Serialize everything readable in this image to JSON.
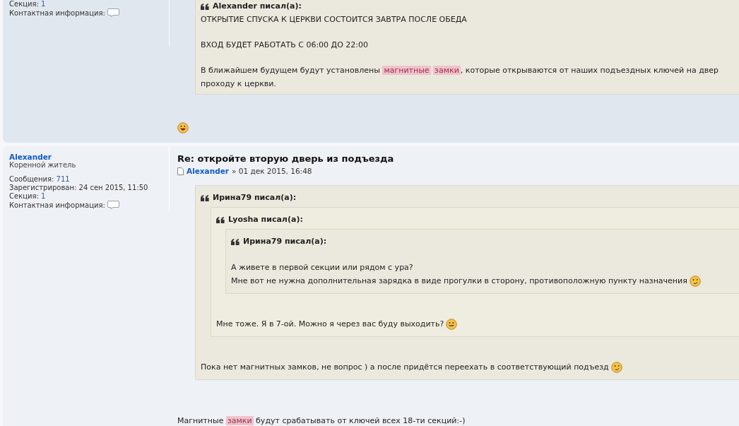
{
  "posts": [
    {
      "profile": {
        "fields": [
          {
            "kind": "text",
            "label": "Секция:",
            "value": "1",
            "link": true
          },
          {
            "kind": "contact",
            "label": "Контактная информация:"
          }
        ]
      },
      "body": [
        {
          "kind": "quote",
          "header": "Alexander писал(а):",
          "body": [
            {
              "kind": "paragraph",
              "lines": [
                {
                  "segments": [
                    {
                      "kind": "text",
                      "text": "ОТКРЫТИЕ СПУСКА К ЦЕРКВИ СОСТОИТСЯ ЗАВТРА ПОСЛЕ ОБЕДА"
                    }
                  ]
                }
              ]
            },
            {
              "kind": "paragraph",
              "lines": [
                {
                  "segments": [
                    {
                      "kind": "text",
                      "text": "ВХОД БУДЕТ РАБОТАТЬ С 06:00 ДО 22:00"
                    }
                  ]
                }
              ]
            },
            {
              "kind": "paragraph",
              "lines": [
                {
                  "segments": [
                    {
                      "kind": "text",
                      "text": "В ближайшем будущем будут установлены "
                    },
                    {
                      "kind": "highlight",
                      "text": "магнитные "
                    },
                    {
                      "kind": "highlight",
                      "text": "замки"
                    },
                    {
                      "kind": "text",
                      "text": ", которые открываются от наших подъездных ключей на двер"
                    }
                  ]
                },
                {
                  "segments": [
                    {
                      "kind": "text",
                      "text": "проходу к церкви."
                    }
                  ]
                }
              ]
            }
          ]
        },
        {
          "kind": "paragraph",
          "lines": [
            {
              "end_icon": {
                "kind": "grin"
              }
            }
          ]
        }
      ]
    },
    {
      "profile": {
        "name": "Alexander",
        "rank": "Коренной житель",
        "fields": [
          {
            "kind": "text",
            "label": "Сообщения:",
            "value": "711",
            "link": true
          },
          {
            "kind": "text",
            "label": "Зарегистрирован:",
            "value": "24 сен 2015, 11:50",
            "link": false
          },
          {
            "kind": "text",
            "label": "Секция:",
            "value": "1",
            "link": true
          },
          {
            "kind": "contact",
            "label": "Контактная информация:"
          }
        ]
      },
      "title": "Re: откройте вторую дверь из подъезда",
      "meta": {
        "author": "Alexander",
        "date": "» 01 дек 2015, 16:48"
      },
      "body": [
        {
          "kind": "quote",
          "header": "Ирина79 писал(а):",
          "body": [
            {
              "kind": "quote",
              "header": "Lyosha писал(а):",
              "body": [
                {
                  "kind": "quote",
                  "header": "Ирина79 писал(а):",
                  "body": [
                    {
                      "kind": "paragraph",
                      "lines": [
                        {
                          "segments": [
                            {
                              "kind": "text",
                              "text": "А живете в первой секции или рядом с ура?"
                            }
                          ]
                        },
                        {
                          "segments": [
                            {
                              "kind": "text",
                              "text": "Мне вот не нужна дополнительная зарядка в виде прогулки в сторону, противоположную пункту назначения"
                            }
                          ],
                          "end_icon": {
                            "kind": "wink"
                          }
                        }
                      ]
                    }
                  ]
                },
                {
                  "kind": "paragraph",
                  "lines": [
                    {
                      "segments": [
                        {
                          "kind": "text",
                          "text": "Мне тоже. Я в 7-ой. Можно я через вас буду выходить?"
                        }
                      ],
                      "end_icon": {
                        "kind": "smile"
                      }
                    }
                  ]
                }
              ]
            },
            {
              "kind": "paragraph",
              "lines": [
                {
                  "segments": [
                    {
                      "kind": "text",
                      "text": "Пока нет магнитных замков, не вопрос ) а после придётся переехать в соответствующий подъезд"
                    }
                  ],
                  "end_icon": {
                    "kind": "wink"
                  }
                }
              ]
            }
          ]
        },
        {
          "kind": "post-text",
          "lines": [
            {
              "segments": [
                {
                  "kind": "text",
                  "text": "Магнитные "
                },
                {
                  "kind": "highlight",
                  "text": "замки"
                },
                {
                  "kind": "text",
                  "text": " будут срабатывать от ключей всех 18-ти секций:-)"
                }
              ]
            }
          ]
        }
      ]
    }
  ]
}
